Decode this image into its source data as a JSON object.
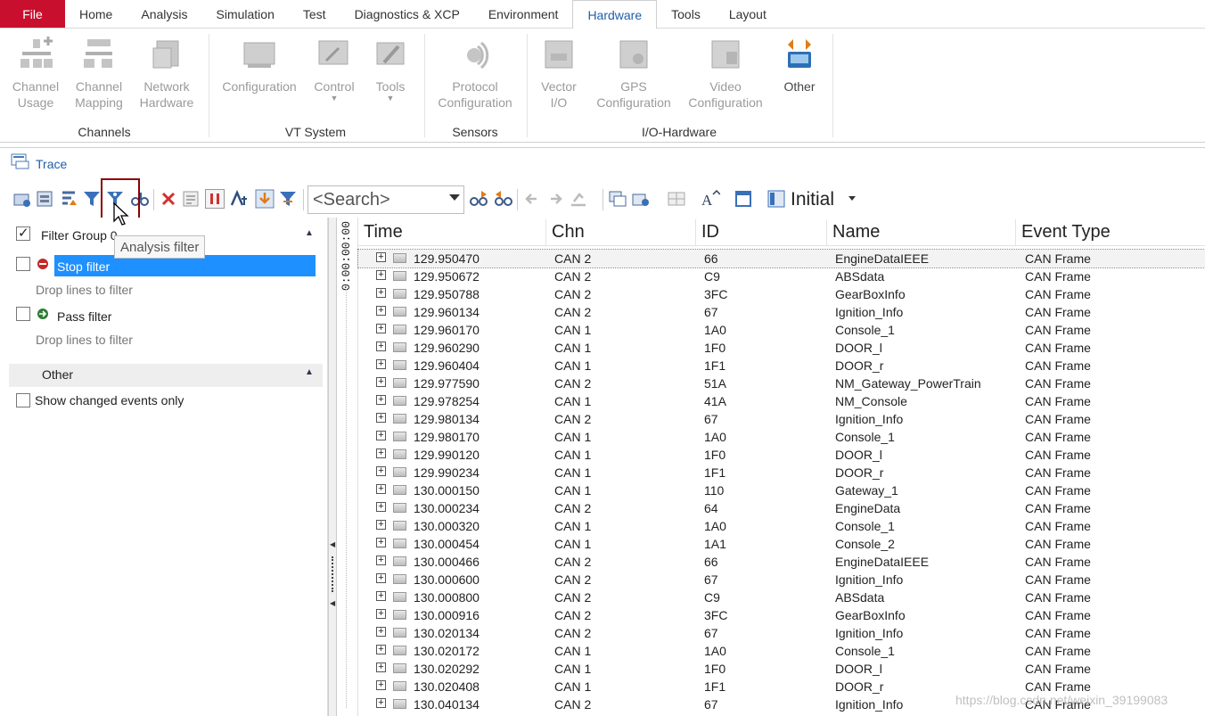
{
  "menu": {
    "file": "File",
    "tabs": [
      "Home",
      "Analysis",
      "Simulation",
      "Test",
      "Diagnostics & XCP",
      "Environment",
      "Hardware",
      "Tools",
      "Layout"
    ],
    "active_tab": "Hardware"
  },
  "ribbon": {
    "channel_usage": [
      "Channel",
      "Usage"
    ],
    "channel_mapping": [
      "Channel",
      "Mapping"
    ],
    "network_hardware": [
      "Network",
      "Hardware"
    ],
    "configuration": "Configuration",
    "control": "Control",
    "tools": "Tools",
    "protocol_configuration": [
      "Protocol",
      "Configuration"
    ],
    "vector_io": [
      "Vector",
      "I/O"
    ],
    "gps_configuration": [
      "GPS",
      "Configuration"
    ],
    "video_configuration": [
      "Video",
      "Configuration"
    ],
    "other": "Other",
    "groups": {
      "channels": "Channels",
      "vt_system": "VT System",
      "sensors": "Sensors",
      "io_hardware": "I/O-Hardware"
    }
  },
  "trace": {
    "title": "Trace",
    "search_placeholder": "<Search>",
    "layout_name": "Initial",
    "tooltip": "Analysis filter"
  },
  "filter_panel": {
    "group_label": "Filter Group 0",
    "stop_filter": "Stop filter",
    "stop_hint": "Drop lines to filter",
    "pass_filter": "Pass filter",
    "pass_hint": "Drop lines to filter",
    "other_header": "Other",
    "show_changed": "Show changed events only",
    "group_checked": true
  },
  "time_ruler": "0:00:00:00",
  "columns": [
    "Time",
    "Chn",
    "ID",
    "Name",
    "Event Type"
  ],
  "rows": [
    {
      "time": "129.950470",
      "chn": "CAN 2",
      "id": "66",
      "name": "EngineDataIEEE",
      "evt": "CAN Frame"
    },
    {
      "time": "129.950672",
      "chn": "CAN 2",
      "id": "C9",
      "name": "ABSdata",
      "evt": "CAN Frame"
    },
    {
      "time": "129.950788",
      "chn": "CAN 2",
      "id": "3FC",
      "name": "GearBoxInfo",
      "evt": "CAN Frame"
    },
    {
      "time": "129.960134",
      "chn": "CAN 2",
      "id": "67",
      "name": "Ignition_Info",
      "evt": "CAN Frame"
    },
    {
      "time": "129.960170",
      "chn": "CAN 1",
      "id": "1A0",
      "name": "Console_1",
      "evt": "CAN Frame"
    },
    {
      "time": "129.960290",
      "chn": "CAN 1",
      "id": "1F0",
      "name": "DOOR_l",
      "evt": "CAN Frame"
    },
    {
      "time": "129.960404",
      "chn": "CAN 1",
      "id": "1F1",
      "name": "DOOR_r",
      "evt": "CAN Frame"
    },
    {
      "time": "129.977590",
      "chn": "CAN 2",
      "id": "51A",
      "name": "NM_Gateway_PowerTrain",
      "evt": "CAN Frame"
    },
    {
      "time": "129.978254",
      "chn": "CAN 1",
      "id": "41A",
      "name": "NM_Console",
      "evt": "CAN Frame"
    },
    {
      "time": "129.980134",
      "chn": "CAN 2",
      "id": "67",
      "name": "Ignition_Info",
      "evt": "CAN Frame"
    },
    {
      "time": "129.980170",
      "chn": "CAN 1",
      "id": "1A0",
      "name": "Console_1",
      "evt": "CAN Frame"
    },
    {
      "time": "129.990120",
      "chn": "CAN 1",
      "id": "1F0",
      "name": "DOOR_l",
      "evt": "CAN Frame"
    },
    {
      "time": "129.990234",
      "chn": "CAN 1",
      "id": "1F1",
      "name": "DOOR_r",
      "evt": "CAN Frame"
    },
    {
      "time": "130.000150",
      "chn": "CAN 1",
      "id": "110",
      "name": "Gateway_1",
      "evt": "CAN Frame"
    },
    {
      "time": "130.000234",
      "chn": "CAN 2",
      "id": "64",
      "name": "EngineData",
      "evt": "CAN Frame"
    },
    {
      "time": "130.000320",
      "chn": "CAN 1",
      "id": "1A0",
      "name": "Console_1",
      "evt": "CAN Frame"
    },
    {
      "time": "130.000454",
      "chn": "CAN 1",
      "id": "1A1",
      "name": "Console_2",
      "evt": "CAN Frame"
    },
    {
      "time": "130.000466",
      "chn": "CAN 2",
      "id": "66",
      "name": "EngineDataIEEE",
      "evt": "CAN Frame"
    },
    {
      "time": "130.000600",
      "chn": "CAN 2",
      "id": "67",
      "name": "Ignition_Info",
      "evt": "CAN Frame"
    },
    {
      "time": "130.000800",
      "chn": "CAN 2",
      "id": "C9",
      "name": "ABSdata",
      "evt": "CAN Frame"
    },
    {
      "time": "130.000916",
      "chn": "CAN 2",
      "id": "3FC",
      "name": "GearBoxInfo",
      "evt": "CAN Frame"
    },
    {
      "time": "130.020134",
      "chn": "CAN 2",
      "id": "67",
      "name": "Ignition_Info",
      "evt": "CAN Frame"
    },
    {
      "time": "130.020172",
      "chn": "CAN 1",
      "id": "1A0",
      "name": "Console_1",
      "evt": "CAN Frame"
    },
    {
      "time": "130.020292",
      "chn": "CAN 1",
      "id": "1F0",
      "name": "DOOR_l",
      "evt": "CAN Frame"
    },
    {
      "time": "130.020408",
      "chn": "CAN 1",
      "id": "1F1",
      "name": "DOOR_r",
      "evt": "CAN Frame"
    },
    {
      "time": "130.040134",
      "chn": "CAN 2",
      "id": "67",
      "name": "Ignition_Info",
      "evt": "CAN Frame"
    }
  ],
  "watermark": "https://blog.csdn.net/weixin_39199083",
  "colors": {
    "file_tab": "#c8102e",
    "accent": "#1f5fa8",
    "selection": "#1e90ff",
    "highlight_frame": "#8b0000"
  }
}
